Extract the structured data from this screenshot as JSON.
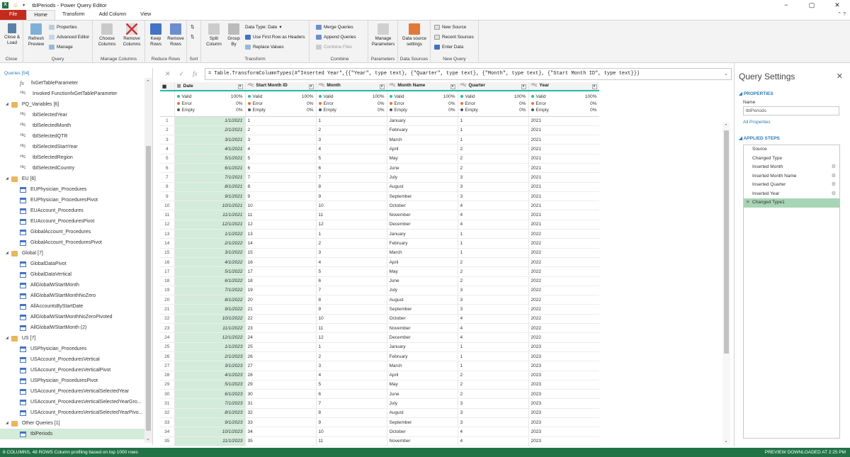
{
  "app": {
    "title": "tblPeriods - Power Query Editor",
    "window_controls": [
      "−",
      "▢",
      "✕"
    ]
  },
  "tabs": [
    "File",
    "Home",
    "Transform",
    "Add Column",
    "View"
  ],
  "ribbon": {
    "close_load": "Close & Load",
    "refresh_preview": "Refresh Preview",
    "properties": "Properties",
    "advanced_editor": "Advanced Editor",
    "manage": "Manage",
    "choose_columns": "Choose Columns",
    "remove_columns": "Remove Columns",
    "keep_rows": "Keep Rows",
    "remove_rows": "Remove Rows",
    "split_column": "Split Column",
    "group_by": "Group By",
    "data_type": "Data Type: Date",
    "first_row_headers": "Use First Row as Headers",
    "replace_values": "Replace Values",
    "merge_queries": "Merge Queries",
    "append_queries": "Append Queries",
    "combine_files": "Combine Files",
    "manage_parameters": "Manage Parameters",
    "data_source_settings": "Data source settings",
    "new_source": "New Source",
    "recent_sources": "Recent Sources",
    "enter_data": "Enter Data",
    "groups": {
      "close": "Close",
      "query": "Query",
      "manage_columns": "Manage Columns",
      "reduce_rows": "Reduce Rows",
      "sort": "Sort",
      "transform": "Transform",
      "combine": "Combine",
      "parameters": "Parameters",
      "data_sources": "Data Sources",
      "new_query": "New Query"
    }
  },
  "formula": "= Table.TransformColumnTypes(#\"Inserted Year\",{{\"Year\", type text}, {\"Quarter\", type text}, {\"Month\", type text}, {\"Start Month ID\", type text}})",
  "queries": {
    "header": "Queries [54]",
    "items": [
      {
        "kind": "fx",
        "label": "fxGetTableParameter",
        "level": "item"
      },
      {
        "kind": "abc",
        "label": "Invoked FunctionfxGetTableParameter",
        "level": "item"
      },
      {
        "kind": "folder",
        "label": "PQ_Variables [6]",
        "level": "grp"
      },
      {
        "kind": "abc",
        "label": "tblSelectedYear",
        "level": "item"
      },
      {
        "kind": "abc",
        "label": "tblSelectedMonth",
        "level": "item"
      },
      {
        "kind": "abc",
        "label": "tblSelectedQTR",
        "level": "item"
      },
      {
        "kind": "abc",
        "label": "tblSelectedStartYear",
        "level": "item"
      },
      {
        "kind": "abc",
        "label": "tblSelectedRegion",
        "level": "item"
      },
      {
        "kind": "abc",
        "label": "tblSelectedCountry",
        "level": "item"
      },
      {
        "kind": "folder",
        "label": "EU [6]",
        "level": "grp"
      },
      {
        "kind": "table",
        "label": "EUPhysician_Procedures",
        "level": "item"
      },
      {
        "kind": "table",
        "label": "EUPhysician_ProceduresPivot",
        "level": "item"
      },
      {
        "kind": "table",
        "label": "EUAccount_Procedures",
        "level": "item"
      },
      {
        "kind": "table",
        "label": "EUAccount_ProceduresPivot",
        "level": "item"
      },
      {
        "kind": "table",
        "label": "GlobalAccount_Procedures",
        "level": "item"
      },
      {
        "kind": "table",
        "label": "GlobalAccount_ProceduresPivot",
        "level": "item"
      },
      {
        "kind": "folder",
        "label": "Global [7]",
        "level": "grp"
      },
      {
        "kind": "table",
        "label": "GlobalDataPivot",
        "level": "item"
      },
      {
        "kind": "table",
        "label": "GlobalDataVertical",
        "level": "item"
      },
      {
        "kind": "table",
        "label": "AllGlobalWStartMonth",
        "level": "item"
      },
      {
        "kind": "table",
        "label": "AllGlobalWStartMonthNoZero",
        "level": "item"
      },
      {
        "kind": "table",
        "label": "AllAccountsByStartDate",
        "level": "item"
      },
      {
        "kind": "table",
        "label": "AllGlobalWStartMonthNoZeroPivoted",
        "level": "item"
      },
      {
        "kind": "table",
        "label": "AllGlobalWStartMonth (2)",
        "level": "item"
      },
      {
        "kind": "folder",
        "label": "US [7]",
        "level": "grp"
      },
      {
        "kind": "table",
        "label": "USPhysician_Procedures",
        "level": "item"
      },
      {
        "kind": "table",
        "label": "USAccount_ProceduresVertical",
        "level": "item"
      },
      {
        "kind": "table",
        "label": "USAccount_ProceduresVerticalPivot",
        "level": "item"
      },
      {
        "kind": "table",
        "label": "USPhysician_ProceduresPivot",
        "level": "item"
      },
      {
        "kind": "table",
        "label": "USAccount_ProceduresVerticalSelectedYear",
        "level": "item"
      },
      {
        "kind": "table",
        "label": "USAccount_ProceduresVerticalSelectedYearGro...",
        "level": "item"
      },
      {
        "kind": "table",
        "label": "USAccount_ProceduresVerticalSelectedYearPivo...",
        "level": "item"
      },
      {
        "kind": "folder",
        "label": "Other Queries [1]",
        "level": "grp"
      },
      {
        "kind": "table",
        "label": "tblPeriods",
        "level": "item",
        "selected": true
      }
    ]
  },
  "grid": {
    "columns": [
      {
        "icon": "▦",
        "name": "Date"
      },
      {
        "icon": "ᴬᴮc",
        "name": "Start Month ID"
      },
      {
        "icon": "ᴬᴮc",
        "name": "Month"
      },
      {
        "icon": "ᴬᴮc",
        "name": "Month Name"
      },
      {
        "icon": "ᴬᴮc",
        "name": "Quarter"
      },
      {
        "icon": "ᴬᴮc",
        "name": "Year"
      }
    ],
    "profile": [
      {
        "valid": "100%",
        "error": "0%",
        "empty": "0%"
      },
      {
        "valid": "100%",
        "error": "0%",
        "empty": "0%"
      },
      {
        "valid": "100%",
        "error": "0%",
        "empty": "0%"
      },
      {
        "valid": "100%",
        "error": "0%",
        "empty": "0%"
      },
      {
        "valid": "100%",
        "error": "0%",
        "empty": "0%"
      },
      {
        "valid": "100%",
        "error": "0%",
        "empty": "0%"
      }
    ],
    "profile_labels": {
      "valid": "Valid",
      "error": "Error",
      "empty": "Empty"
    },
    "rows": [
      [
        "1/1/2021",
        "1",
        "1",
        "January",
        "1",
        "2021"
      ],
      [
        "2/1/2021",
        "2",
        "2",
        "February",
        "1",
        "2021"
      ],
      [
        "3/1/2021",
        "3",
        "3",
        "March",
        "1",
        "2021"
      ],
      [
        "4/1/2021",
        "4",
        "4",
        "April",
        "2",
        "2021"
      ],
      [
        "5/1/2021",
        "5",
        "5",
        "May",
        "2",
        "2021"
      ],
      [
        "6/1/2021",
        "6",
        "6",
        "June",
        "2",
        "2021"
      ],
      [
        "7/1/2021",
        "7",
        "7",
        "July",
        "3",
        "2021"
      ],
      [
        "8/1/2021",
        "8",
        "8",
        "August",
        "3",
        "2021"
      ],
      [
        "9/1/2021",
        "9",
        "9",
        "September",
        "3",
        "2021"
      ],
      [
        "10/1/2021",
        "10",
        "10",
        "October",
        "4",
        "2021"
      ],
      [
        "11/1/2021",
        "11",
        "11",
        "November",
        "4",
        "2021"
      ],
      [
        "12/1/2021",
        "12",
        "12",
        "December",
        "4",
        "2021"
      ],
      [
        "1/1/2022",
        "13",
        "1",
        "January",
        "1",
        "2022"
      ],
      [
        "2/1/2022",
        "14",
        "2",
        "February",
        "1",
        "2022"
      ],
      [
        "3/1/2022",
        "15",
        "3",
        "March",
        "1",
        "2022"
      ],
      [
        "4/1/2022",
        "16",
        "4",
        "April",
        "2",
        "2022"
      ],
      [
        "5/1/2022",
        "17",
        "5",
        "May",
        "2",
        "2022"
      ],
      [
        "6/1/2022",
        "18",
        "6",
        "June",
        "2",
        "2022"
      ],
      [
        "7/1/2022",
        "19",
        "7",
        "July",
        "3",
        "2022"
      ],
      [
        "8/1/2022",
        "20",
        "8",
        "August",
        "3",
        "2022"
      ],
      [
        "9/1/2022",
        "21",
        "9",
        "September",
        "3",
        "2022"
      ],
      [
        "10/1/2022",
        "22",
        "10",
        "October",
        "4",
        "2022"
      ],
      [
        "11/1/2022",
        "23",
        "11",
        "November",
        "4",
        "2022"
      ],
      [
        "12/1/2022",
        "24",
        "12",
        "December",
        "4",
        "2022"
      ],
      [
        "1/1/2023",
        "25",
        "1",
        "January",
        "1",
        "2023"
      ],
      [
        "2/1/2023",
        "26",
        "2",
        "February",
        "1",
        "2023"
      ],
      [
        "3/1/2023",
        "27",
        "3",
        "March",
        "1",
        "2023"
      ],
      [
        "4/1/2023",
        "28",
        "4",
        "April",
        "2",
        "2023"
      ],
      [
        "5/1/2023",
        "29",
        "5",
        "May",
        "2",
        "2023"
      ],
      [
        "6/1/2023",
        "30",
        "6",
        "June",
        "2",
        "2023"
      ],
      [
        "7/1/2023",
        "31",
        "7",
        "July",
        "3",
        "2023"
      ],
      [
        "8/1/2023",
        "32",
        "8",
        "August",
        "3",
        "2023"
      ],
      [
        "9/1/2023",
        "33",
        "9",
        "September",
        "3",
        "2023"
      ],
      [
        "10/1/2023",
        "34",
        "10",
        "October",
        "4",
        "2023"
      ],
      [
        "11/1/2023",
        "35",
        "11",
        "November",
        "4",
        "2023"
      ]
    ]
  },
  "settings": {
    "title": "Query Settings",
    "properties_header": "PROPERTIES",
    "name_label": "Name",
    "name_value": "tblPeriods",
    "all_properties": "All Properties",
    "steps_header": "APPLIED STEPS",
    "steps": [
      {
        "label": "Source",
        "gear": false
      },
      {
        "label": "Changed Type",
        "gear": false
      },
      {
        "label": "Inserted Month",
        "gear": true
      },
      {
        "label": "Inserted Month Name",
        "gear": true
      },
      {
        "label": "Inserted Quarter",
        "gear": true
      },
      {
        "label": "Inserted Year",
        "gear": true
      },
      {
        "label": "Changed Type1",
        "gear": false,
        "selected": true
      }
    ]
  },
  "status": {
    "left": "6 COLUMNS, 48 ROWS     Column profiling based on top 1000 rows",
    "right": "PREVIEW DOWNLOADED AT 2:25 PM"
  },
  "colors": {
    "accent_green": "#217346",
    "file_tab": "#c42b1c",
    "selection": "#d3ebd9",
    "profile_bar": "#1ebea5"
  }
}
